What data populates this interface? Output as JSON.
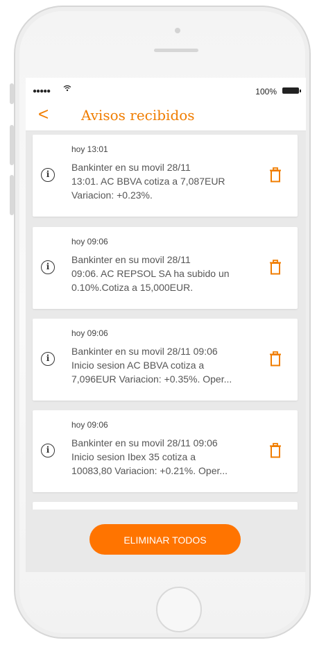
{
  "status_bar": {
    "signal": "●●●●●",
    "wifi_icon": "wifi-icon",
    "battery_pct": "100%"
  },
  "header": {
    "back_icon": "chevron-left-icon",
    "back_glyph": "<",
    "title": "Avisos recibidos"
  },
  "colors": {
    "accent": "#f07d00",
    "button": "#ff7400",
    "background": "#e9e9e9"
  },
  "notifications": [
    {
      "time": "hoy 13:01",
      "lines": [
        "Bankinter en su movil 28/11",
        "13:01. AC BBVA cotiza a 7,087EUR",
        "Variacion: +0.23%."
      ]
    },
    {
      "time": "hoy 09:06",
      "lines": [
        "Bankinter en su movil 28/11",
        "09:06. AC REPSOL SA ha subido un",
        "0.10%.Cotiza a 15,000EUR."
      ]
    },
    {
      "time": "hoy 09:06",
      "lines": [
        "Bankinter en su movil 28/11 09:06",
        "Inicio sesion AC BBVA cotiza a",
        "7,096EUR Variacion: +0.35%. Oper..."
      ]
    },
    {
      "time": "hoy 09:06",
      "lines": [
        "Bankinter en su movil 28/11 09:06",
        "Inicio sesion Ibex 35 cotiza a",
        "10083,80 Variacion: +0.21%. Oper..."
      ]
    }
  ],
  "icons": {
    "info": "info-icon",
    "delete": "trash-icon",
    "info_glyph": "i"
  },
  "actions": {
    "clear_all": "ELIMINAR TODOS"
  }
}
